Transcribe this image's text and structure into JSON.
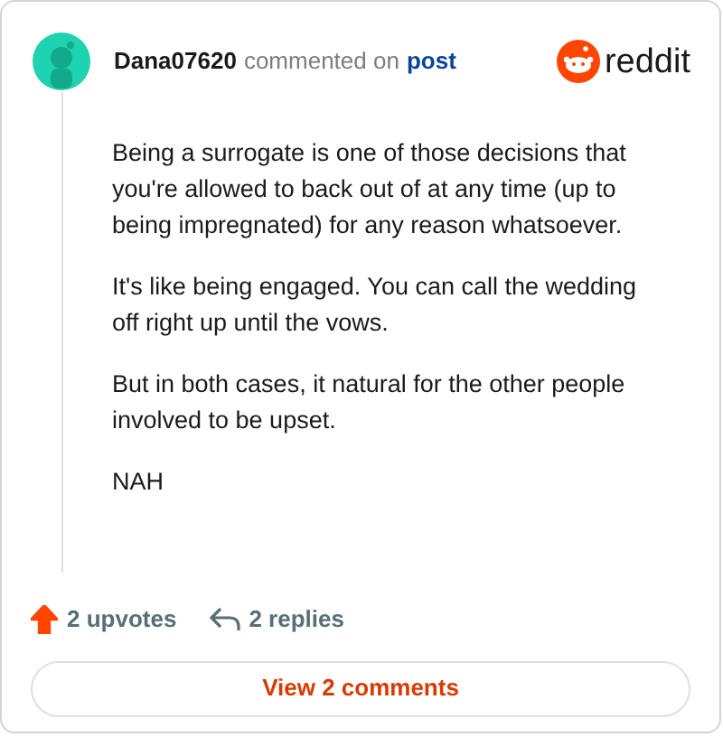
{
  "comment": {
    "author": "Dana07620",
    "action": "commented on",
    "link": "post"
  },
  "logo": {
    "wordmark": "reddit"
  },
  "body": [
    "Being a surrogate is one of those decisions that you're allowed to back out of at any time (up to being impregnated) for any reason whatsoever.",
    "It's like being engaged. You can call the wedding off right up until the vows.",
    "But in both cases, it natural for the other people involved to be upset.",
    "NAH"
  ],
  "stats": {
    "upvotes": "2 upvotes",
    "upvoted": true,
    "replies": "2 replies"
  },
  "button": "View 2 comments"
}
